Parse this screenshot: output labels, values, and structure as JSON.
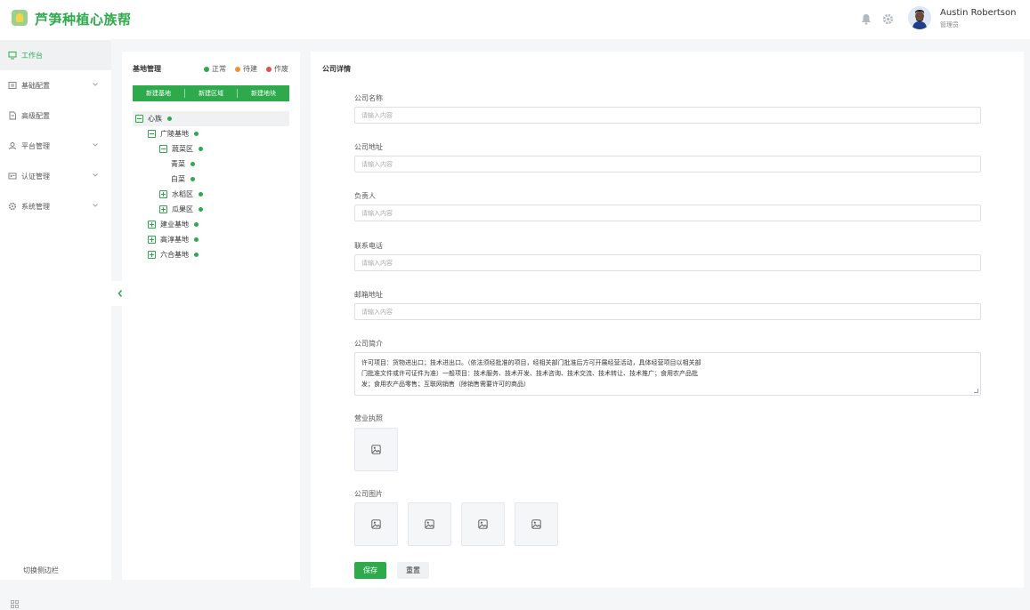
{
  "app": {
    "title": "芦笋种植心族帮"
  },
  "header": {
    "user_name": "Austin Robertson",
    "user_role": "管理员"
  },
  "sidebar": {
    "items": [
      {
        "label": "工作台",
        "icon": "monitor-icon",
        "active": true
      },
      {
        "label": "基础配置",
        "icon": "settings-list-icon"
      },
      {
        "label": "高级配置",
        "icon": "document-icon"
      },
      {
        "label": "平台管理",
        "icon": "user-icon"
      },
      {
        "label": "认证管理",
        "icon": "badge-icon"
      },
      {
        "label": "系统管理",
        "icon": "gear-icon"
      }
    ],
    "toggle_label": "切换侧边栏"
  },
  "tree_panel": {
    "title": "基地管理",
    "legend": [
      {
        "label": "正常",
        "color": "#2eaa4c"
      },
      {
        "label": "待建",
        "color": "#f5922f"
      },
      {
        "label": "作废",
        "color": "#ee4b4b"
      }
    ],
    "buttons": [
      "新建基地",
      "新建区域",
      "新建地块"
    ],
    "nodes": [
      {
        "label": "心族",
        "expanded": true
      },
      {
        "label": "广陵基地",
        "expanded": true
      },
      {
        "label": "蔬菜区",
        "expanded": true
      },
      {
        "label": "青菜"
      },
      {
        "label": "白菜"
      },
      {
        "label": "水稻区",
        "expanded": false
      },
      {
        "label": "瓜果区",
        "expanded": false
      },
      {
        "label": "建业基地",
        "expanded": false
      },
      {
        "label": "高淳基地",
        "expanded": false
      },
      {
        "label": "六合基地",
        "expanded": false
      }
    ]
  },
  "form": {
    "title": "公司详情",
    "fields": [
      {
        "label": "公司名称",
        "placeholder": "请输入内容"
      },
      {
        "label": "公司地址",
        "placeholder": "请输入内容"
      },
      {
        "label": "负责人",
        "placeholder": "请输入内容"
      },
      {
        "label": "联系电话",
        "placeholder": "请输入内容"
      },
      {
        "label": "邮箱地址",
        "placeholder": "请输入内容"
      }
    ],
    "intro_label": "公司简介",
    "intro_lines": [
      "许可项目：货物进出口；技术进出口。（依法须经批准的项目，经相关部门批准后方可开展经营活动，具体经营项目以相关部",
      "门批准文件或许可证件为准）一般项目：技术服务、技术开发、技术咨询、技术交流、技术转让、技术推广；食用农产品批",
      "发；食用农产品零售；互联网销售（除销售需要许可的商品）"
    ],
    "license_label": "营业执照",
    "photos_label": "公司图片",
    "save_label": "保存",
    "reset_label": "重置"
  }
}
